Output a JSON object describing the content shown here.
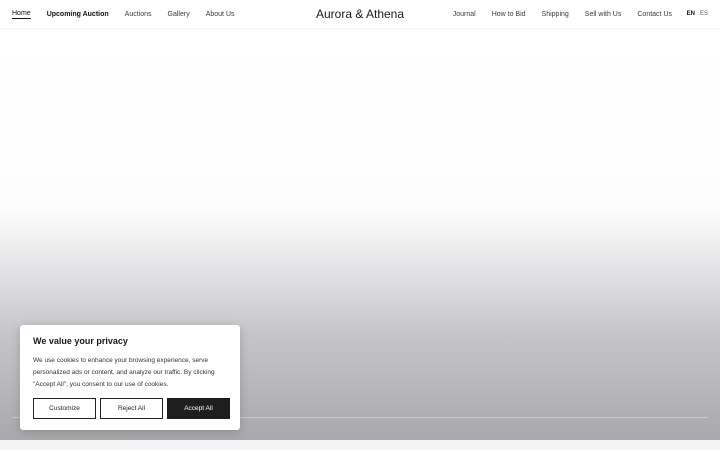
{
  "header": {
    "brand": "Aurora & Athena",
    "nav_left": [
      {
        "label": "Home"
      },
      {
        "label": "Upcoming Auction"
      },
      {
        "label": "Auctions"
      },
      {
        "label": "Gallery"
      },
      {
        "label": "About Us"
      }
    ],
    "nav_right": [
      {
        "label": "Journal"
      },
      {
        "label": "How to Bid"
      },
      {
        "label": "Shipping"
      },
      {
        "label": "Sell with Us"
      },
      {
        "label": "Contact Us"
      }
    ],
    "languages": [
      {
        "label": "EN",
        "selected": true
      },
      {
        "label": "ES",
        "selected": false
      }
    ]
  },
  "cookie_banner": {
    "title": "We value your privacy",
    "body": "We use cookies to enhance your browsing experience, serve personalized ads or content, and analyze our traffic. By clicking \"Accept All\", you consent to our use of cookies.",
    "buttons": {
      "customize": "Customize",
      "reject": "Reject All",
      "accept": "Accept All"
    }
  },
  "colors": {
    "accent": "#1e1e1e",
    "background": "#ffffff",
    "hero_bottom": "#a9a9ad"
  }
}
